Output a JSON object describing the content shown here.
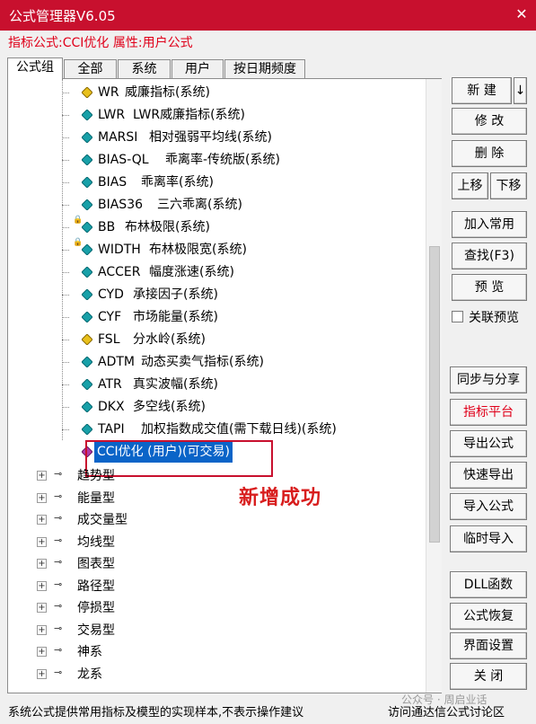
{
  "window": {
    "title": "公式管理器V6.05",
    "close_glyph": "✕"
  },
  "info": "指标公式:CCI优化 属性:用户公式",
  "tabs": [
    "公式组",
    "全部",
    "系统",
    "用户",
    "按日期频度"
  ],
  "formulas": [
    {
      "code": "WR",
      "name": "威廉指标(系统)",
      "icon": "yellow"
    },
    {
      "code": "LWR",
      "name": "LWR威廉指标(系统)",
      "icon": "teal"
    },
    {
      "code": "MARSI",
      "name": "相对强弱平均线(系统)",
      "icon": "teal"
    },
    {
      "code": "BIAS-QL",
      "name": "乖离率-传统版(系统)",
      "icon": "teal"
    },
    {
      "code": "BIAS",
      "name": "乖离率(系统)",
      "icon": "teal"
    },
    {
      "code": "BIAS36",
      "name": "三六乖离(系统)",
      "icon": "teal"
    },
    {
      "code": "BB",
      "name": "布林极限(系统)",
      "icon": "teal",
      "locked": true
    },
    {
      "code": "WIDTH",
      "name": "布林极限宽(系统)",
      "icon": "teal",
      "locked": true
    },
    {
      "code": "ACCER",
      "name": "幅度涨速(系统)",
      "icon": "teal"
    },
    {
      "code": "CYD",
      "name": "承接因子(系统)",
      "icon": "teal"
    },
    {
      "code": "CYF",
      "name": "市场能量(系统)",
      "icon": "teal"
    },
    {
      "code": "FSL",
      "name": "分水岭(系统)",
      "icon": "yellow"
    },
    {
      "code": "ADTM",
      "name": "动态买卖气指标(系统)",
      "icon": "teal"
    },
    {
      "code": "ATR",
      "name": "真实波幅(系统)",
      "icon": "teal"
    },
    {
      "code": "DKX",
      "name": "多空线(系统)",
      "icon": "teal"
    },
    {
      "code": "TAPI",
      "name": "加权指数成交值(需下载日线)(系统)",
      "icon": "teal"
    }
  ],
  "selected": {
    "label": "CCI优化 (用户)(可交易)",
    "icon": "purple"
  },
  "annotation": "新增成功",
  "groups": [
    "趋势型",
    "能量型",
    "成交量型",
    "均线型",
    "图表型",
    "路径型",
    "停损型",
    "交易型",
    "神系",
    "龙系"
  ],
  "buttons": {
    "new": "新 建",
    "new_arrow": "↓",
    "edit": "修 改",
    "delete": "删 除",
    "up": "上移",
    "down": "下移",
    "add_common": "加入常用",
    "find": "查找(F3)",
    "preview": "预 览",
    "linked_preview": "关联预览",
    "sync_share": "同步与分享",
    "indicator_platform": "指标平台",
    "export_formula": "导出公式",
    "quick_export": "快速导出",
    "import_formula": "导入公式",
    "temp_import": "临时导入",
    "dll_func": "DLL函数",
    "formula_restore": "公式恢复",
    "ui_settings": "界面设置",
    "close": "关 闭"
  },
  "status": {
    "left": "系统公式提供常用指标及模型的实现样本,不表示操作建议",
    "right": "访问通达信公式讨论区"
  },
  "watermark": "公众号 · 周启业话",
  "colors": {
    "title_bar": "#c8102e",
    "info_text": "#e0001a",
    "selection": "#0a64c8",
    "annotation": "#d81e1e"
  }
}
